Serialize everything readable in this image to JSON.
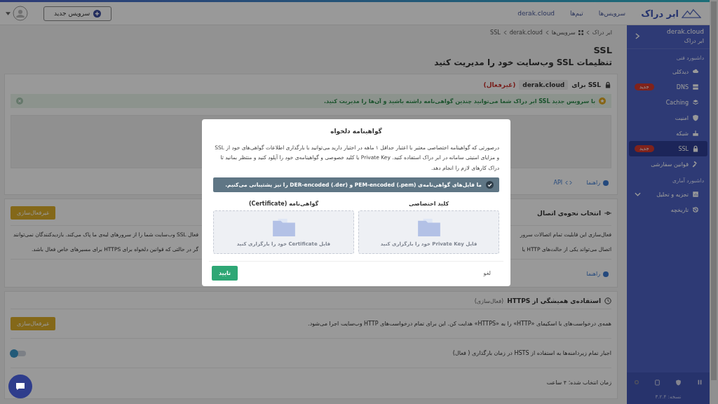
{
  "topbar": {
    "brand": "ابر دراک",
    "nav": [
      {
        "label": "سرویس‌ها"
      },
      {
        "label": "تیم‌ها"
      },
      {
        "label": "derak.cloud"
      }
    ],
    "new_service_button": "سرویس جدید"
  },
  "sidebar": {
    "domain": "derak.cloud",
    "subtitle": "ابر دراک",
    "sections": [
      {
        "title": "داشبورد فنی",
        "items": [
          {
            "label": "دیدکلی",
            "kind": "link",
            "selected": false
          },
          {
            "label": "DNS",
            "kind": "link",
            "selected": false,
            "badge": "جدید"
          },
          {
            "label": "Caching",
            "kind": "link",
            "selected": false
          },
          {
            "label": "امنیت",
            "kind": "link",
            "selected": false
          },
          {
            "label": "شبکه",
            "kind": "link",
            "selected": false
          },
          {
            "label": "SSL",
            "kind": "link",
            "selected": true,
            "badge": "جدید"
          },
          {
            "label": "قوانین سفارشی",
            "kind": "link",
            "selected": false
          }
        ]
      },
      {
        "title": "داشبورد آماری",
        "items": [
          {
            "label": "تجزیه و تحلیل",
            "kind": "group",
            "selected": false
          },
          {
            "label": "تاریخچه",
            "kind": "link",
            "selected": false
          }
        ]
      }
    ],
    "version": "نسخه: ۳.۲.۴"
  },
  "breadcrumb": [
    "ابر دراک",
    "سرویس‌ها",
    "derak.cloud",
    "SSL"
  ],
  "page": {
    "title": "SSL",
    "subtitle": "تنظیمات SSL وب‌سایت خود را مدیریت کنید"
  },
  "ssl_card": {
    "label": "SSL برای",
    "domain": "derak.cloud",
    "status": "(غیرفعال)",
    "alert": "با سرویس جدید SSL ابر دراک شما می‌توانید چندین گواهی‌نامه داشته باشید و آن‌ها را مدیریت کنید.",
    "links": [
      "راهنما",
      "API"
    ]
  },
  "connection_card": {
    "title": "انتخاب نحوه‌ی اتصال",
    "button": "غیرفعال‌سازی",
    "lines": [
      {
        "start": "فعال‌سازی این قابلیت تمام اتصالات سرور",
        "end": "فعال SSL وب‌سایت شما را از سرورهای لبه‌ی ما پاک می‌کند. بازدیدکنندگان نمی‌توانند"
      },
      {
        "start": "اتصال می‌تواند یکی از حالت‌های HTTP یا",
        "end": "گر در حالتی که قوانین دلخواه برای HTTPS برای مسیرهای خاص فعال باشد."
      }
    ],
    "link": "راهنما"
  },
  "https_card": {
    "title": "استفاده‌ی همیشگی از HTTPS",
    "state": "(فعال‌سازی)",
    "redirect_text": "همه‌ی درخواست‌های با اسکیمای «HTTP» را به «HTTPS» هدایت کن. این برای تمام درخواست‌های HTTP وب‌سایت اجرا می‌شود.",
    "button": "غیرفعال‌سازی",
    "hsts_text": "اجبار تمام زیردامنه‌ها به استفاده از HSTS در زمان بارگذاری ( فعال)",
    "hsts_on": false,
    "time_text": "زمان انتخاب شده: ۴ ساعت"
  },
  "modal": {
    "title": "گواهینامه دلخواه",
    "text": "درصورتی که گواهینامه اختصاصی معتبر با اعتبار حداقل ۱ ماهه در اختیار دارید می‌توانید با بارگذاری اطلاعات گواهی‌های خود از SSL و مزایای امنیتی سامانه در ابر دراک استفاده کنید. Private Key یا کلید خصوصی و گواهینامه‌ی خود را آپلود کنید و منتظر بمانید تا دراک کارهای لازم را انجام دهد.",
    "info": "ما فایل‌های گواهی‌نامه‌ی PEM-encoded (.pem) و DER-encoded (.der) را نیز پشتیبانی می‌کنیم.",
    "uploads": [
      {
        "label": "کلید اختصاصی",
        "hint": "فایل Private Key خود را بارگزاری کنید"
      },
      {
        "label": "گواهی‌نامه (Certificate)",
        "hint": "فایل Certificate خود را بارگزاری کنید"
      }
    ],
    "cancel": "لغو",
    "confirm": "تایید"
  }
}
